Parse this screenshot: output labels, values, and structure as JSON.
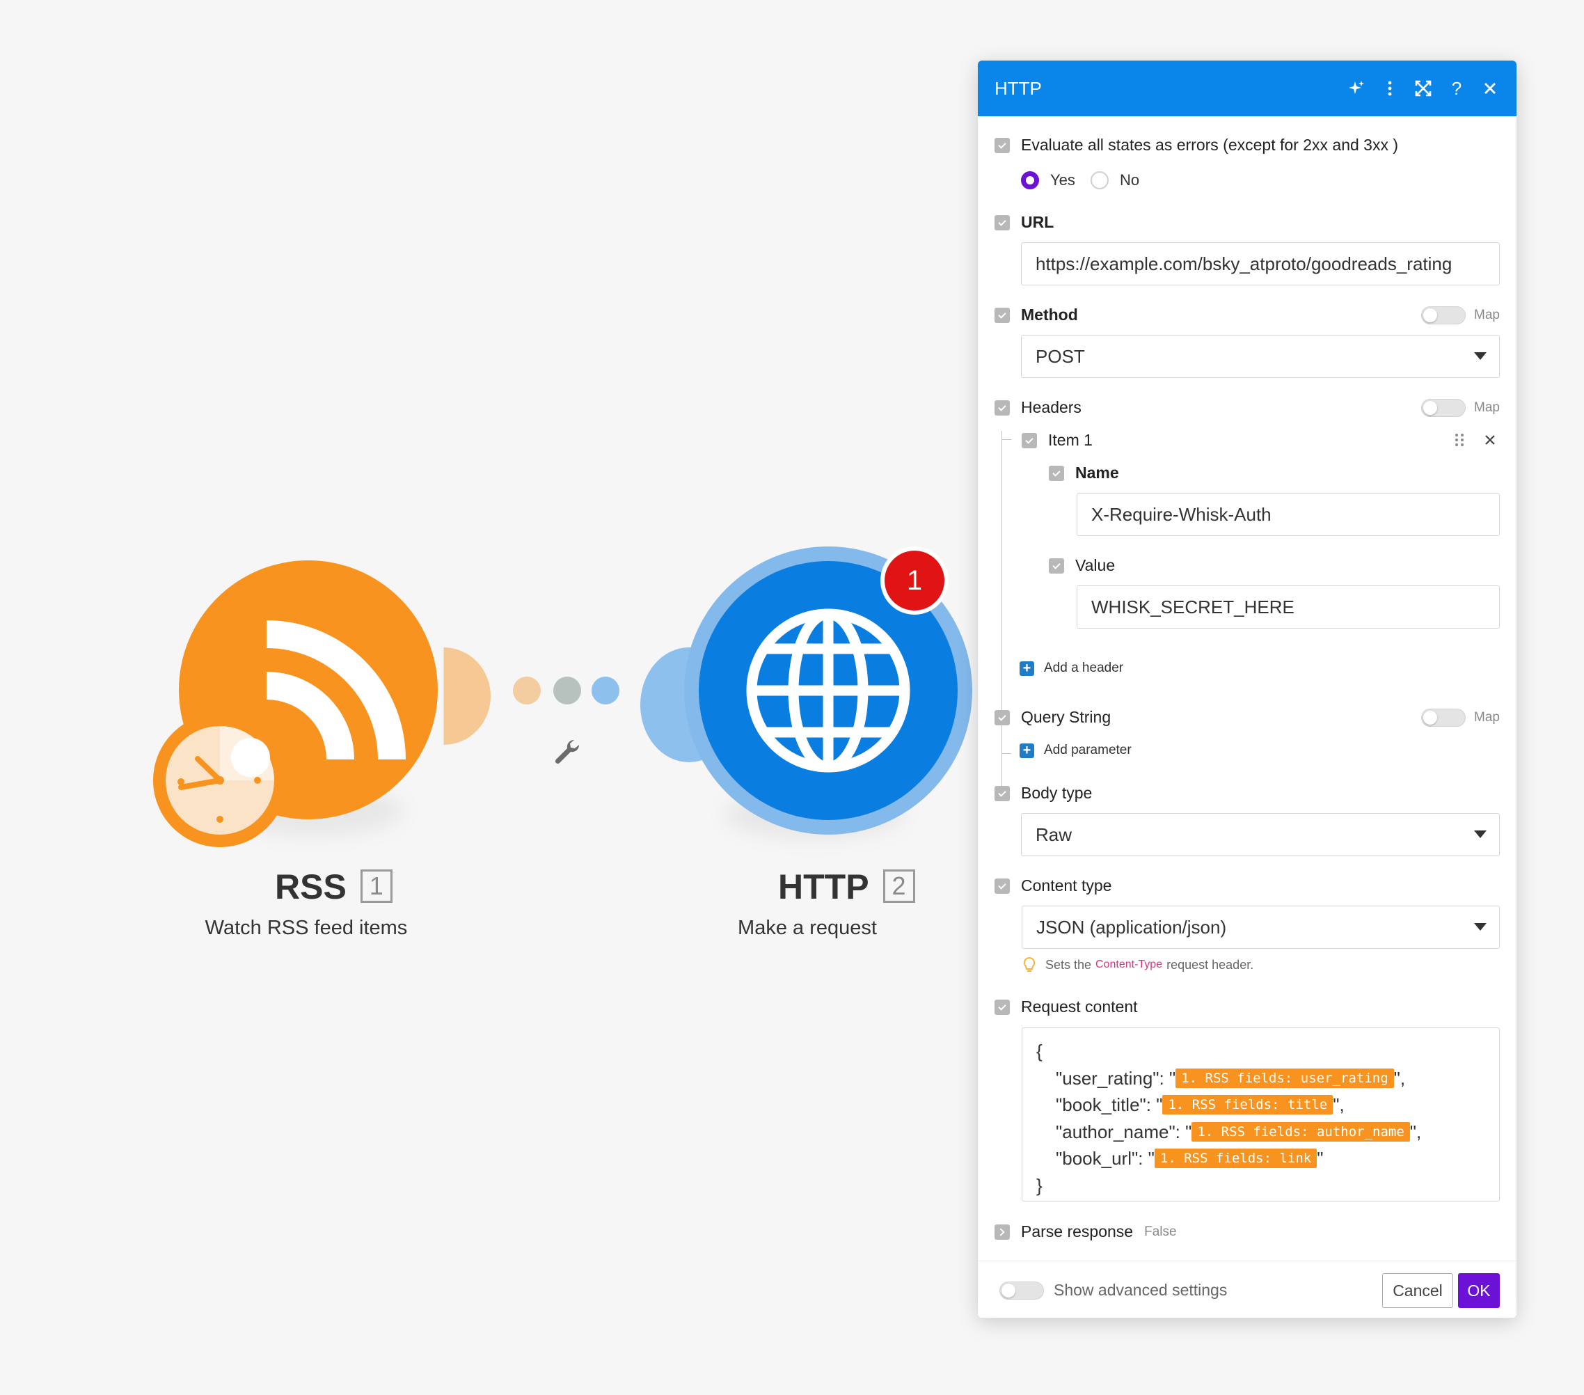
{
  "canvas": {
    "modules": [
      {
        "name": "RSS",
        "number": "1",
        "subtitle": "Watch RSS feed items",
        "color": "#f7931e"
      },
      {
        "name": "HTTP",
        "number": "2",
        "subtitle": "Make a request",
        "color": "#0a7ee0",
        "badge": "1"
      }
    ],
    "connector_icon": "wrench-icon"
  },
  "panel": {
    "title": "HTTP",
    "header_icons": [
      "sparkle-icon",
      "more-vertical-icon",
      "expand-icon",
      "help-icon",
      "close-icon"
    ],
    "evaluate_errors": {
      "label": "Evaluate all states as errors (except for 2xx and 3xx )",
      "options": [
        "Yes",
        "No"
      ],
      "selected": "Yes"
    },
    "url": {
      "label": "URL",
      "value": "https://example.com/bsky_atproto/goodreads_rating"
    },
    "method": {
      "label": "Method",
      "value": "POST",
      "map_label": "Map"
    },
    "headers": {
      "label": "Headers",
      "map_label": "Map",
      "item_label": "Item 1",
      "name_label": "Name",
      "name_value": "X-Require-Whisk-Auth",
      "value_label": "Value",
      "value_value": "WHISK_SECRET_HERE",
      "add_label": "Add a header"
    },
    "query_string": {
      "label": "Query String",
      "map_label": "Map",
      "add_label": "Add parameter"
    },
    "body_type": {
      "label": "Body type",
      "value": "Raw"
    },
    "content_type": {
      "label": "Content type",
      "value": "JSON (application/json)",
      "hint_prefix": "Sets the",
      "hint_code": "Content-Type",
      "hint_suffix": "request header."
    },
    "request_content": {
      "label": "Request content",
      "open": "{",
      "close": "}",
      "lines": [
        {
          "key": "\"user_rating\": \"",
          "pill": "1. RSS fields: user_rating",
          "end": "\","
        },
        {
          "key": "\"book_title\": \"",
          "pill": "1. RSS fields: title",
          "end": "\","
        },
        {
          "key": "\"author_name\": \"",
          "pill": "1. RSS fields: author_name",
          "end": "\","
        },
        {
          "key": "\"book_url\": \"",
          "pill": "1. RSS fields: link",
          "end": "\""
        }
      ]
    },
    "parse_response": {
      "label": "Parse response",
      "value": "False"
    },
    "footer": {
      "advanced_label": "Show advanced settings",
      "cancel": "Cancel",
      "ok": "OK"
    }
  }
}
